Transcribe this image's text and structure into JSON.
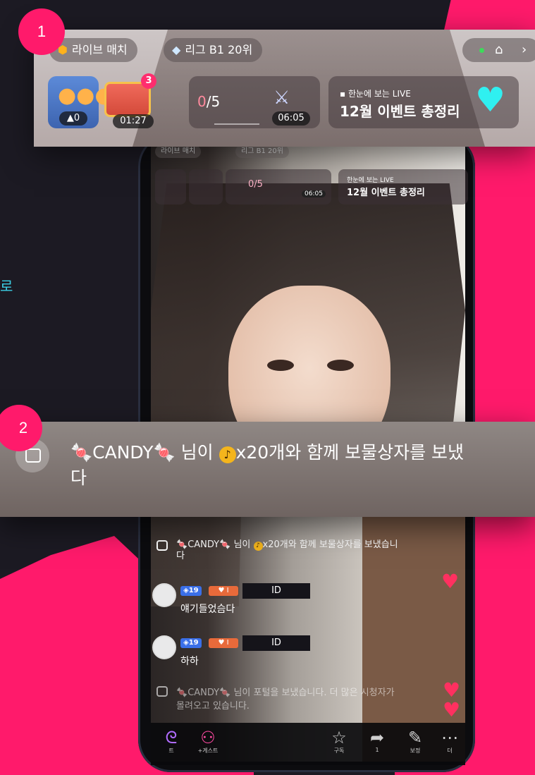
{
  "side_text": "로",
  "hud": {
    "live_match": "라이브 매치",
    "league": "리그 B1 20위",
    "viewer_count": "0",
    "treasure_badge": "3",
    "treasure_timer": "01:27",
    "mission_current": "0",
    "mission_total": "/5",
    "battle_timer": "06:05",
    "event_small": "한눈에 보는 LIVE",
    "event_title": "12월 이벤트 총정리"
  },
  "callouts": [
    "1",
    "2"
  ],
  "gift_message": {
    "sender": "CANDY",
    "line1_pre": "님이",
    "coin_amount": "x20개와 함께 보물상자를 보냈습니",
    "line2": "다",
    "zoom_line1": "님이",
    "zoom_coin": "x20개와 함께 보물상자를 보냈",
    "zoom_line2": "다"
  },
  "chat": [
    {
      "level": "19",
      "fan": "I",
      "user_id": "ID",
      "message": "얘기들었슴다"
    },
    {
      "level": "19",
      "fan": "I",
      "user_id": "ID",
      "message": "하하"
    }
  ],
  "portal_notice": "님이 포털을 보냈습니다. 더 많은 시청자가",
  "portal_notice_line2": "몰려오고 있습니다.",
  "bottom_bar": [
    {
      "label": "트",
      "icon": "live-icon"
    },
    {
      "label": "+게스트",
      "icon": "guests-icon"
    },
    {
      "label": "구독",
      "icon": "subscribe-icon"
    },
    {
      "label": "1",
      "icon": "share-icon"
    },
    {
      "label": "보정",
      "icon": "beauty-icon"
    },
    {
      "label": "더",
      "icon": "more-icon"
    }
  ],
  "colors": {
    "accent": "#ff1a6b",
    "text_accent": "#3bd0e6"
  }
}
